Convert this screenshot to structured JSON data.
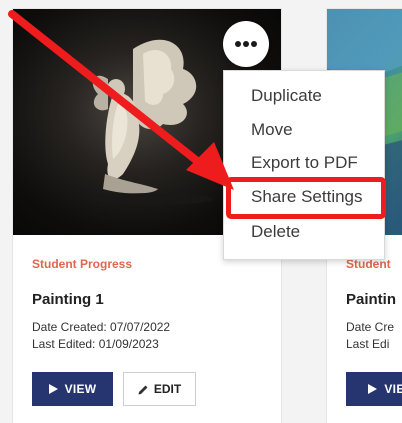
{
  "cards": [
    {
      "category": "Student Progress",
      "title": "Painting 1",
      "date_created": "Date Created: 07/07/2022",
      "last_edited": "Last Edited: 01/09/2023",
      "view_label": "VIEW",
      "edit_label": "EDIT"
    },
    {
      "category": "Student",
      "title": "Paintin",
      "date_created": "Date Cre",
      "last_edited": "Last Edi",
      "view_label": "VIE"
    }
  ],
  "menu": {
    "items": [
      {
        "label": "Duplicate"
      },
      {
        "label": "Move"
      },
      {
        "label": "Export to PDF"
      },
      {
        "label": "Share Settings"
      },
      {
        "label": "Delete"
      }
    ],
    "highlighted_item": "Share Settings"
  },
  "icons": {
    "more": "more-options-icon",
    "view": "play-icon",
    "edit": "pencil-icon"
  },
  "colors": {
    "category_text": "#e0674e",
    "view_button": "#26356f",
    "annotation": "#ee1c1c"
  }
}
